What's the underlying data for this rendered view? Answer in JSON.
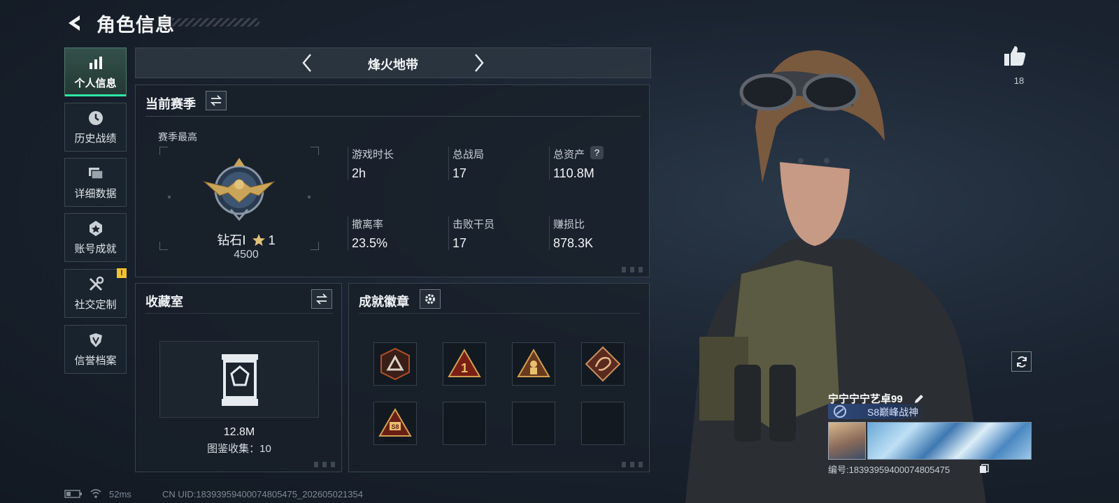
{
  "header": {
    "title": "角色信息"
  },
  "sidebar": {
    "items": [
      {
        "label": "个人信息",
        "icon": "bar-chart-icon",
        "active": true
      },
      {
        "label": "历史战绩",
        "icon": "clock-icon",
        "active": false
      },
      {
        "label": "详细数据",
        "icon": "folders-icon",
        "active": false
      },
      {
        "label": "账号成就",
        "icon": "badge-star-icon",
        "active": false
      },
      {
        "label": "社交定制",
        "icon": "tools-icon",
        "active": false,
        "alert": "!"
      },
      {
        "label": "信誉档案",
        "icon": "shield-icon",
        "active": false
      }
    ]
  },
  "mode": {
    "label": "烽火地带"
  },
  "season": {
    "title": "当前赛季",
    "best_label": "赛季最高",
    "rank_name": "钻石Ⅰ",
    "rank_stars": "1",
    "rank_score": "4500",
    "stats": [
      {
        "label": "游戏时长",
        "value": "2h"
      },
      {
        "label": "总战局",
        "value": "17"
      },
      {
        "label": "总资产",
        "value": "110.8M",
        "help": "?"
      },
      {
        "label": "撤离率",
        "value": "23.5%"
      },
      {
        "label": "击败干员",
        "value": "17"
      },
      {
        "label": "赚损比",
        "value": "878.3K"
      }
    ]
  },
  "collection": {
    "title": "收藏室",
    "value": "12.8M",
    "caption": "图鉴收集：10"
  },
  "achievements": {
    "title": "成就徽章",
    "slots_filled": 5,
    "slots_total": 8
  },
  "profile": {
    "likes": "18",
    "name": "宁宁宁宁艺卓99",
    "title_tag": "S8巅峰战神",
    "id_line": "编号:18393959400074805475"
  },
  "status_bar": {
    "ping": "52ms",
    "uid": "CN UID:18393959400074805475_202605021354"
  },
  "colors": {
    "accent_green": "#2ee6a5",
    "alert_yellow": "#f2c230",
    "gold": "#c9a55a"
  }
}
